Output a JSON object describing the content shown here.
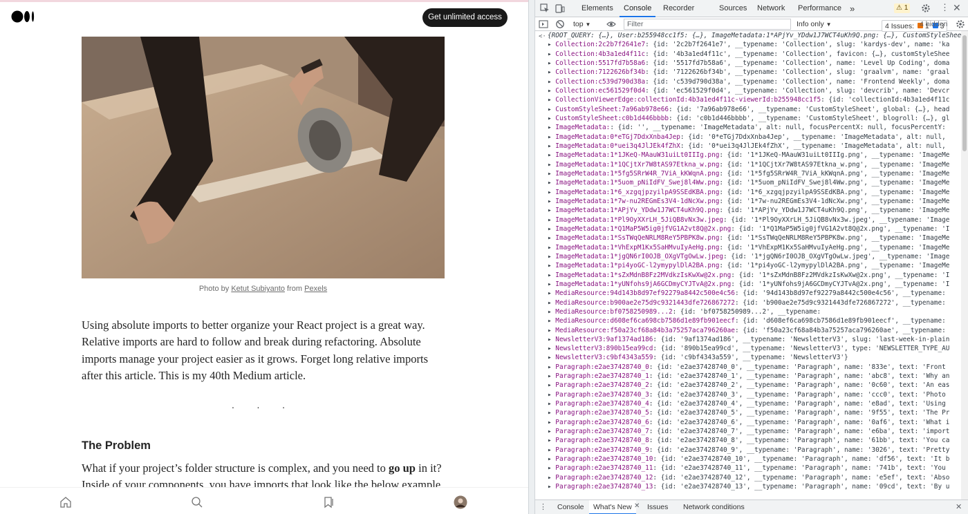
{
  "article": {
    "cta_label": "Get unlimited access",
    "caption": {
      "prefix": "Photo by ",
      "author": "Ketut Subiyanto",
      "mid": " from ",
      "source": "Pexels"
    },
    "intro": "Using absolute imports to better organize your React project is a great way. Relative imports are hard to follow and break during refactoring. Absolute imports manage your project easier as it grows. Forget long relative imports after this article. This is my 40th Medium article.",
    "separator": "· · ·",
    "section_heading": "The Problem",
    "section_p_start": "What if your project’s folder structure is complex, and you need to ",
    "section_p_bold": "go up",
    "section_p_end": " in it? Inside of your components, you have imports that look like the below example."
  },
  "devtools": {
    "tabs": [
      "Elements",
      "Console",
      "Recorder",
      "Sources",
      "Network",
      "Performance",
      "»"
    ],
    "active_tab": "Console",
    "badge_count": "1",
    "issues_label": "4 Issues:",
    "issues_count_a": "1",
    "issues_count_b": "3",
    "hidden_label": "4 hidden",
    "context_select": "top",
    "filter_placeholder": "Filter",
    "level_select": "Info only",
    "drawer_tabs": [
      "Console",
      "What's New",
      "Issues",
      "Network conditions"
    ],
    "drawer_active": "What's New",
    "root_line": "{ROOT_QUERY: {…}, User:b255948cc1f5: {…}, ImageMetadata:1*APjYv_YDdw1J7WCT4uKh9Q.png: {…}, CustomStyleSheet:7a96ab978e66: {…}, Collection:4b3a1ed4f11c: {…}, …}",
    "entries": [
      [
        "Collection:2c2b7f2641e7",
        "{id: '2c2b7f2641e7', __typename: 'Collection', slug: 'kardys-dev', name: 'ka"
      ],
      [
        "Collection:4b3a1ed4f11c",
        "{id: '4b3a1ed4f11c', __typename: 'Collection', favicon: {…}, customStyleShee"
      ],
      [
        "Collection:5517fd7b58a6",
        "{id: '5517fd7b58a6', __typename: 'Collection', name: 'Level Up Coding', doma"
      ],
      [
        "Collection:7122626bf34b",
        "{id: '7122626bf34b', __typename: 'Collection', slug: 'graalvm', name: 'graal"
      ],
      [
        "Collection:c539d790d38a",
        "{id: 'c539d790d38a', __typename: 'Collection', name: 'Frontend Weekly', doma"
      ],
      [
        "Collection:ec561529f0d4",
        "{id: 'ec561529f0d4', __typename: 'Collection', slug: 'devcrib', name: 'Devcr"
      ],
      [
        "CollectionViewerEdge:collectionId:4b3a1ed4f11c-viewerId:b255948cc1f5",
        "{id: 'collectionId:4b3a1ed4f11c"
      ],
      [
        "CustomStyleSheet:7a96ab978e66",
        "{id: '7a96ab978e66', __typename: 'CustomStyleSheet', global: {…}, head"
      ],
      [
        "CustomStyleSheet:c0b1d446bbbb",
        "{id: 'c0b1d446bbbb', __typename: 'CustomStyleSheet', blogroll: {…}, gl"
      ],
      [
        "ImageMetadata:",
        "{id: '', __typename: 'ImageMetadata', alt: null, focusPercentX: null, focusPercentY:"
      ],
      [
        "ImageMetadata:0*eTGj7DdxXnba4Jep",
        "{id: '0*eTGj7DdxXnba4Jep', __typename: 'ImageMetadata', alt: null,"
      ],
      [
        "ImageMetadata:0*uei3q4JlJEk4fZhX",
        "{id: '0*uei3q4JlJEk4fZhX', __typename: 'ImageMetadata', alt: null,"
      ],
      [
        "ImageMetadata:1*1JKeQ-MAauW31uiLt0IIIg.png",
        "{id: '1*1JKeQ-MAauW31uiLt0IIIg.png', __typename: 'ImageMe"
      ],
      [
        "ImageMetadata:1*1QCjtXr7W8tAS97Etkna_w.png",
        "{id: '1*1QCjtXr7W8tAS97Etkna_w.png', __typename: 'ImageMe"
      ],
      [
        "ImageMetadata:1*5fg5SRrW4R_7ViA_kKWqnA.png",
        "{id: '1*5fg5SRrW4R_7ViA_kKWqnA.png', __typename: 'ImageMe"
      ],
      [
        "ImageMetadata:1*5uom_pNiIdFV_Swej8l4Ww.png",
        "{id: '1*5uom_pNiIdFV_Swej8l4Ww.png', __typename: 'ImageMe"
      ],
      [
        "ImageMetadata:1*6_xzgqjpzyilpA9SSEdKBA.png",
        "{id: '1*6_xzgqjpzyilpA9SSEdKBA.png', __typename: 'ImageMe"
      ],
      [
        "ImageMetadata:1*7w-nu2REGmEs3V4-1dNcXw.png",
        "{id: '1*7w-nu2REGmEs3V4-1dNcXw.png', __typename: 'ImageMe"
      ],
      [
        "ImageMetadata:1*APjYv_YDdw1J7WCT4uKh9Q.png",
        "{id: '1*APjYv_YDdw1J7WCT4uKh9Q.png', __typename: 'ImageMe"
      ],
      [
        "ImageMetadata:1*Pl9OyXXrLH_5JiQB8vNx3w.jpeg",
        "{id: '1*Pl9OyXXrLH_5JiQB8vNx3w.jpeg', __typename: 'Image"
      ],
      [
        "ImageMetadata:1*Q1MaP5W5ig0jfVG1A2vt8Q@2x.png",
        "{id: '1*Q1MaP5W5ig0jfVG1A2vt8Q@2x.png', __typename: 'I"
      ],
      [
        "ImageMetadata:1*SsTWqQeNRLM8ReY5PBPK8w.png",
        "{id: '1*SsTWqQeNRLM8ReY5PBPK8w.png', __typename: 'ImageMe"
      ],
      [
        "ImageMetadata:1*VhExpM1Kx5SaHMvuIyAeHg.png",
        "{id: '1*VhExpM1Kx5SaHMvuIyAeHg.png', __typename: 'ImageMe"
      ],
      [
        "ImageMetadata:1*jgQN6rI0OJB_OXgVTgOwLw.jpeg",
        "{id: '1*jgQN6rI0OJB_OXgVTgOwLw.jpeg', __typename: 'Image"
      ],
      [
        "ImageMetadata:1*pi4yoGC-l2ymypylDlA2BA.png",
        "{id: '1*pi4yoGC-l2ymypylDlA2BA.png', __typename: 'ImageMe"
      ],
      [
        "ImageMetadata:1*sZxMdnB8Fz2MVdkzIsKwXw@2x.png",
        "{id: '1*sZxMdnB8Fz2MVdkzIsKwXw@2x.png', __typename: 'I"
      ],
      [
        "ImageMetadata:1*yUNfohs9jA6GCDmyCYJTvA@2x.png",
        "{id: '1*yUNfohs9jA6GCDmyCYJTvA@2x.png', __typename: 'I"
      ],
      [
        "MediaResource:94d143b8d97ef92279a8442c500e4c56",
        "{id: '94d143b8d97ef92279a8442c500e4c56', __typename:"
      ],
      [
        "MediaResource:b900ae2e75d9c9321443dfe726867272",
        "{id: 'b900ae2e75d9c9321443dfe726867272', __typename:"
      ],
      [
        "MediaResource:bf0758250989...2",
        "{id: 'bf0758250989...2', __typename:"
      ],
      [
        "MediaResource:d608ef6ca698cb7586d1e89fb901eecf",
        "{id: 'd608ef6ca698cb7586d1e89fb901eecf', __typename:"
      ],
      [
        "MediaResource:f50a23cf68a84b3a75257aca796260ae",
        "{id: 'f50a23cf68a84b3a75257aca796260ae', __typename:"
      ],
      [
        "NewsletterV3:9af1374ad186",
        "{id: '9af1374ad186', __typename: 'NewsletterV3', slug: 'last-week-in-plain"
      ],
      [
        "NewsletterV3:890b15ea99cd",
        "{id: '890b15ea99cd', __typename: 'NewsletterV3', type: 'NEWSLETTER_TYPE_AU"
      ],
      [
        "NewsletterV3:c9bf4343a559",
        "{id: 'c9bf4343a559', __typename: 'NewsletterV3'}"
      ],
      [
        "Paragraph:e2ae37428740_0",
        "{id: 'e2ae37428740_0', __typename: 'Paragraph', name: '833e', text: 'Front"
      ],
      [
        "Paragraph:e2ae37428740_1",
        "{id: 'e2ae37428740_1', __typename: 'Paragraph', name: 'abc8', text: 'Why an"
      ],
      [
        "Paragraph:e2ae37428740_2",
        "{id: 'e2ae37428740_2', __typename: 'Paragraph', name: '0c60', text: 'An eas"
      ],
      [
        "Paragraph:e2ae37428740_3",
        "{id: 'e2ae37428740_3', __typename: 'Paragraph', name: 'ccc0', text: 'Photo"
      ],
      [
        "Paragraph:e2ae37428740_4",
        "{id: 'e2ae37428740_4', __typename: 'Paragraph', name: 'e8ad', text: 'Using"
      ],
      [
        "Paragraph:e2ae37428740_5",
        "{id: 'e2ae37428740_5', __typename: 'Paragraph', name: '9f55', text: 'The Pr"
      ],
      [
        "Paragraph:e2ae37428740_6",
        "{id: 'e2ae37428740_6', __typename: 'Paragraph', name: '0af6', text: 'What i"
      ],
      [
        "Paragraph:e2ae37428740_7",
        "{id: 'e2ae37428740_7', __typename: 'Paragraph', name: 'e6ba', text: 'import"
      ],
      [
        "Paragraph:e2ae37428740_8",
        "{id: 'e2ae37428740_8', __typename: 'Paragraph', name: '61bb', text: 'You ca"
      ],
      [
        "Paragraph:e2ae37428740_9",
        "{id: 'e2ae37428740_9', __typename: 'Paragraph', name: '3026', text: 'Pretty"
      ],
      [
        "Paragraph:e2ae37428740_10",
        "{id: 'e2ae37428740_10', __typename: 'Paragraph', name: 'df56', text: 'It b"
      ],
      [
        "Paragraph:e2ae37428740_11",
        "{id: 'e2ae37428740_11', __typename: 'Paragraph', name: '741b', text: 'You"
      ],
      [
        "Paragraph:e2ae37428740_12",
        "{id: 'e2ae37428740_12', __typename: 'Paragraph', name: 'e5ef', text: 'Abso"
      ],
      [
        "Paragraph:e2ae37428740_13",
        "{id: 'e2ae37428740_13', __typename: 'Paragraph', name: '09cd', text: 'By u"
      ]
    ]
  },
  "colors": {
    "cta_bg": "#191919",
    "devtools_accent": "#1a73e8",
    "key_color": "#881280",
    "string_color": "#c80000"
  }
}
